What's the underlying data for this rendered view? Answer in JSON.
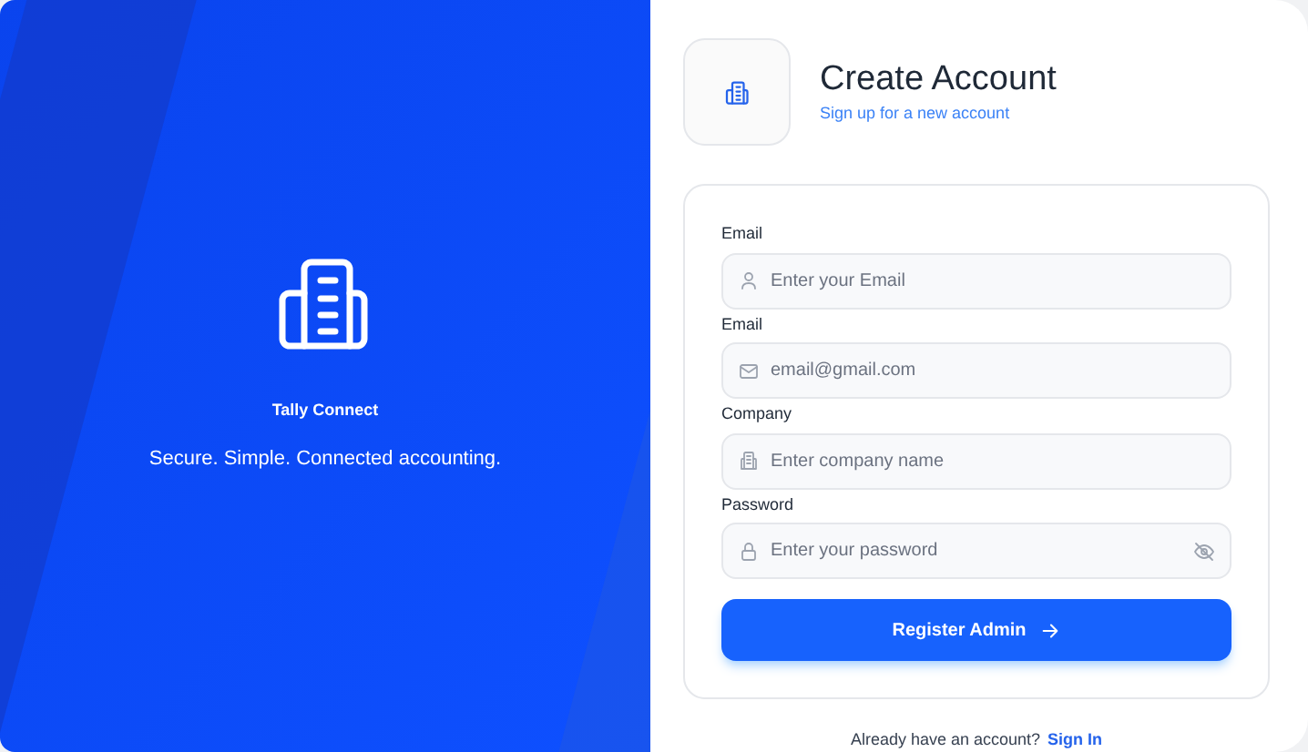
{
  "brand": {
    "name": "Tally Connect",
    "tagline": "Secure. Simple. Connected accounting."
  },
  "header": {
    "title": "Create Account",
    "subtitle": "Sign up for a new account"
  },
  "fields": [
    {
      "label": "Email",
      "placeholder": "Enter your Email",
      "kind": "user"
    },
    {
      "label": "Email",
      "placeholder": "email@gmail.com",
      "kind": "mail"
    },
    {
      "label": "Company",
      "placeholder": "Enter company name",
      "kind": "building"
    },
    {
      "label": "Password",
      "placeholder": "Enter your password",
      "kind": "lock",
      "masked": true
    }
  ],
  "submit": {
    "label": "Register Admin"
  },
  "footer": {
    "text": "Already have an account?",
    "link": "Sign In"
  }
}
